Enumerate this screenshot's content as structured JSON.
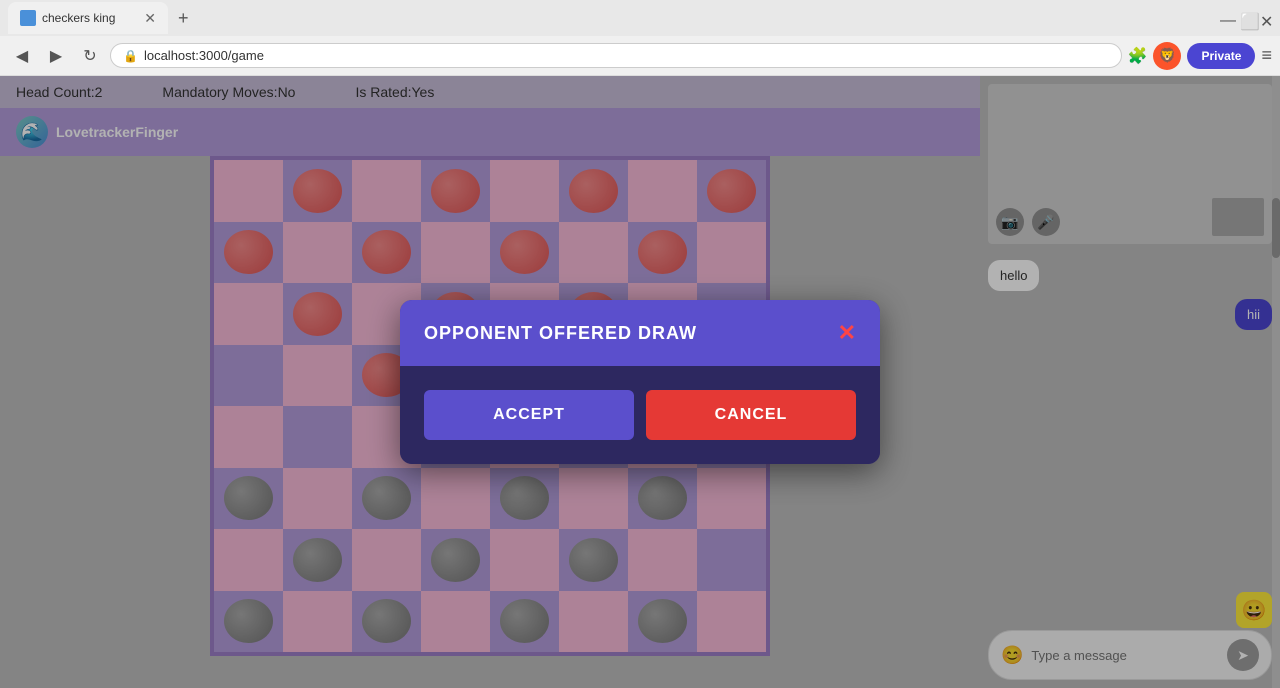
{
  "browser": {
    "tab_title": "checkers king",
    "url": "localhost:3000/game",
    "private_label": "Private",
    "nav": {
      "back": "◀",
      "forward": "▶",
      "reload": "↻"
    }
  },
  "game": {
    "info": {
      "head_count": "Head Count:2",
      "mandatory_moves": "Mandatory Moves:No",
      "is_rated": "Is Rated:Yes"
    },
    "player_name": "LovetrackerFinger"
  },
  "chat": {
    "messages": [
      {
        "text": "hello",
        "type": "received"
      },
      {
        "text": "hii",
        "type": "sent"
      }
    ],
    "input_placeholder": "Type a message"
  },
  "modal": {
    "title": "OPPONENT OFFERED DRAW",
    "accept_label": "ACCEPT",
    "cancel_label": "CANCEL",
    "close_icon": "✕"
  }
}
